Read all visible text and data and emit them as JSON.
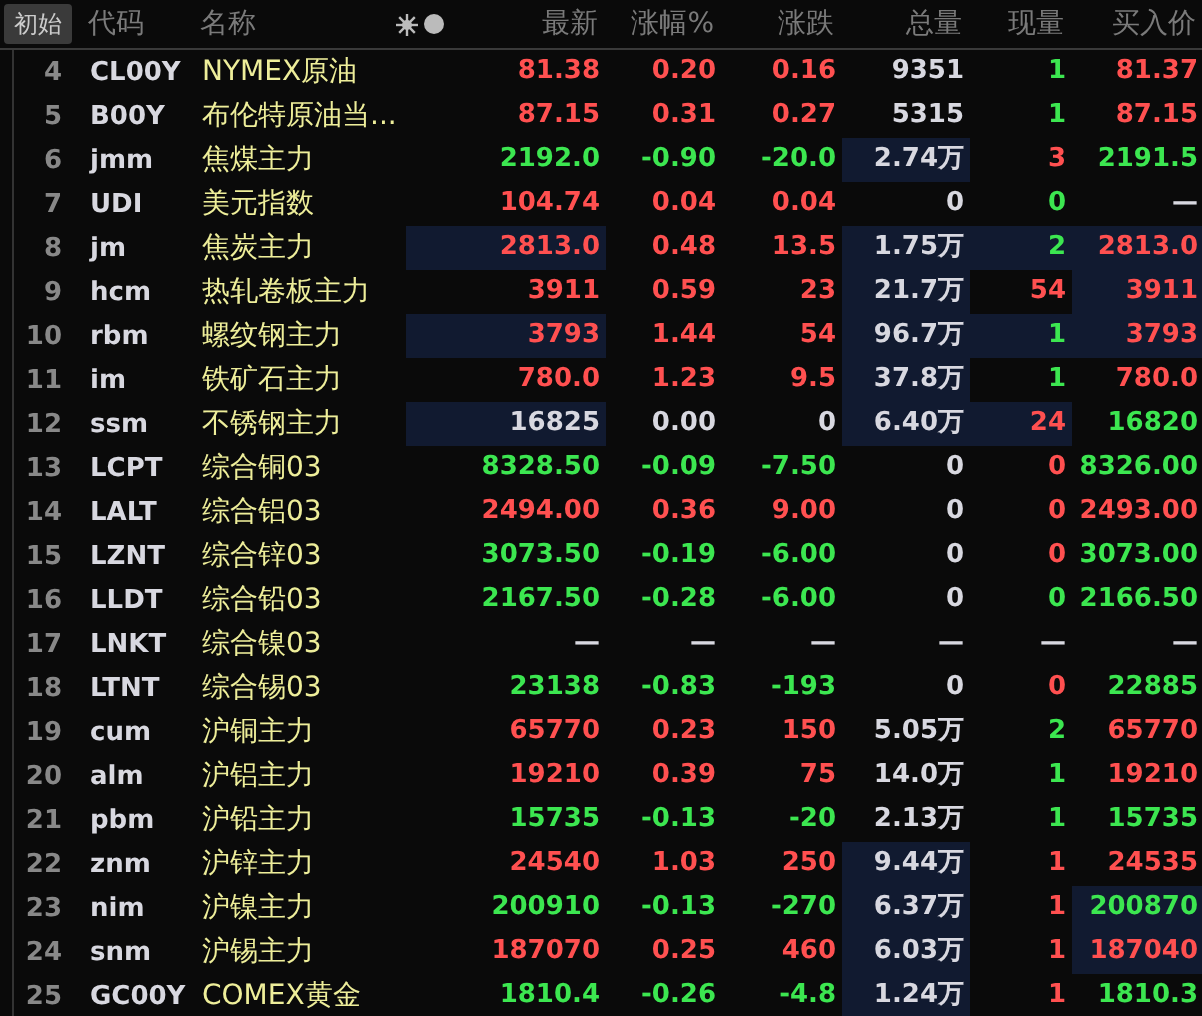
{
  "header": {
    "reset_button": "初始",
    "columns": [
      "代码",
      "名称",
      "最新",
      "涨幅%",
      "涨跌",
      "总量",
      "现量",
      "买入价"
    ]
  },
  "rows": [
    {
      "no": "4",
      "code": "CL00Y",
      "name": "NYMEX原油",
      "cells": [
        {
          "text": "81.38",
          "color": "#ff5050",
          "flash": false
        },
        {
          "text": "0.20",
          "color": "#ff5050",
          "flash": false
        },
        {
          "text": "0.16",
          "color": "#ff5050",
          "flash": false
        },
        {
          "text": "9351",
          "color": "#d8d8e0",
          "flash": false
        },
        {
          "text": "1",
          "color": "#3ce650",
          "flash": false
        },
        {
          "text": "81.37",
          "color": "#ff5050",
          "flash": false
        }
      ]
    },
    {
      "no": "5",
      "code": "B00Y",
      "name": "布伦特原油当...",
      "cells": [
        {
          "text": "87.15",
          "color": "#ff5050",
          "flash": false
        },
        {
          "text": "0.31",
          "color": "#ff5050",
          "flash": false
        },
        {
          "text": "0.27",
          "color": "#ff5050",
          "flash": false
        },
        {
          "text": "5315",
          "color": "#d8d8e0",
          "flash": false
        },
        {
          "text": "1",
          "color": "#3ce650",
          "flash": false
        },
        {
          "text": "87.15",
          "color": "#ff5050",
          "flash": false
        }
      ]
    },
    {
      "no": "6",
      "code": "jmm",
      "name": "焦煤主力",
      "cells": [
        {
          "text": "2192.0",
          "color": "#3ce650",
          "flash": false
        },
        {
          "text": "-0.90",
          "color": "#3ce650",
          "flash": false
        },
        {
          "text": "-20.0",
          "color": "#3ce650",
          "flash": false
        },
        {
          "text": "2.74万",
          "color": "#d8d8e0",
          "flash": true
        },
        {
          "text": "3",
          "color": "#ff5050",
          "flash": false
        },
        {
          "text": "2191.5",
          "color": "#3ce650",
          "flash": false
        }
      ]
    },
    {
      "no": "7",
      "code": "UDI",
      "name": "美元指数",
      "cells": [
        {
          "text": "104.74",
          "color": "#ff5050",
          "flash": false
        },
        {
          "text": "0.04",
          "color": "#ff5050",
          "flash": false
        },
        {
          "text": "0.04",
          "color": "#ff5050",
          "flash": false
        },
        {
          "text": "0",
          "color": "#d8d8e0",
          "flash": false
        },
        {
          "text": "0",
          "color": "#3ce650",
          "flash": false
        },
        {
          "text": "—",
          "color": "#d8d8e0",
          "flash": false
        }
      ]
    },
    {
      "no": "8",
      "code": "jm",
      "name": "焦炭主力",
      "cells": [
        {
          "text": "2813.0",
          "color": "#ff5050",
          "flash": true
        },
        {
          "text": "0.48",
          "color": "#ff5050",
          "flash": false
        },
        {
          "text": "13.5",
          "color": "#ff5050",
          "flash": false
        },
        {
          "text": "1.75万",
          "color": "#d8d8e0",
          "flash": true
        },
        {
          "text": "2",
          "color": "#3ce650",
          "flash": true
        },
        {
          "text": "2813.0",
          "color": "#ff5050",
          "flash": true
        }
      ]
    },
    {
      "no": "9",
      "code": "hcm",
      "name": "热轧卷板主力",
      "cells": [
        {
          "text": "3911",
          "color": "#ff5050",
          "flash": false
        },
        {
          "text": "0.59",
          "color": "#ff5050",
          "flash": false
        },
        {
          "text": "23",
          "color": "#ff5050",
          "flash": false
        },
        {
          "text": "21.7万",
          "color": "#d8d8e0",
          "flash": true
        },
        {
          "text": "54",
          "color": "#ff5050",
          "flash": false
        },
        {
          "text": "3911",
          "color": "#ff5050",
          "flash": true
        }
      ]
    },
    {
      "no": "10",
      "code": "rbm",
      "name": "螺纹钢主力",
      "cells": [
        {
          "text": "3793",
          "color": "#ff5050",
          "flash": true
        },
        {
          "text": "1.44",
          "color": "#ff5050",
          "flash": false
        },
        {
          "text": "54",
          "color": "#ff5050",
          "flash": false
        },
        {
          "text": "96.7万",
          "color": "#d8d8e0",
          "flash": true
        },
        {
          "text": "1",
          "color": "#3ce650",
          "flash": true
        },
        {
          "text": "3793",
          "color": "#ff5050",
          "flash": true
        }
      ]
    },
    {
      "no": "11",
      "code": "im",
      "name": "铁矿石主力",
      "cells": [
        {
          "text": "780.0",
          "color": "#ff5050",
          "flash": false
        },
        {
          "text": "1.23",
          "color": "#ff5050",
          "flash": false
        },
        {
          "text": "9.5",
          "color": "#ff5050",
          "flash": false
        },
        {
          "text": "37.8万",
          "color": "#d8d8e0",
          "flash": true
        },
        {
          "text": "1",
          "color": "#3ce650",
          "flash": false
        },
        {
          "text": "780.0",
          "color": "#ff5050",
          "flash": false
        }
      ]
    },
    {
      "no": "12",
      "code": "ssm",
      "name": "不锈钢主力",
      "cells": [
        {
          "text": "16825",
          "color": "#d8d8e0",
          "flash": true
        },
        {
          "text": "0.00",
          "color": "#d8d8e0",
          "flash": false
        },
        {
          "text": "0",
          "color": "#d8d8e0",
          "flash": false
        },
        {
          "text": "6.40万",
          "color": "#d8d8e0",
          "flash": true
        },
        {
          "text": "24",
          "color": "#ff5050",
          "flash": true
        },
        {
          "text": "16820",
          "color": "#3ce650",
          "flash": false
        }
      ]
    },
    {
      "no": "13",
      "code": "LCPT",
      "name": "综合铜03",
      "cells": [
        {
          "text": "8328.50",
          "color": "#3ce650",
          "flash": false
        },
        {
          "text": "-0.09",
          "color": "#3ce650",
          "flash": false
        },
        {
          "text": "-7.50",
          "color": "#3ce650",
          "flash": false
        },
        {
          "text": "0",
          "color": "#d8d8e0",
          "flash": false
        },
        {
          "text": "0",
          "color": "#ff5050",
          "flash": false
        },
        {
          "text": "8326.00",
          "color": "#3ce650",
          "flash": false
        }
      ]
    },
    {
      "no": "14",
      "code": "LALT",
      "name": "综合铝03",
      "cells": [
        {
          "text": "2494.00",
          "color": "#ff5050",
          "flash": false
        },
        {
          "text": "0.36",
          "color": "#ff5050",
          "flash": false
        },
        {
          "text": "9.00",
          "color": "#ff5050",
          "flash": false
        },
        {
          "text": "0",
          "color": "#d8d8e0",
          "flash": false
        },
        {
          "text": "0",
          "color": "#ff5050",
          "flash": false
        },
        {
          "text": "2493.00",
          "color": "#ff5050",
          "flash": false
        }
      ]
    },
    {
      "no": "15",
      "code": "LZNT",
      "name": "综合锌03",
      "cells": [
        {
          "text": "3073.50",
          "color": "#3ce650",
          "flash": false
        },
        {
          "text": "-0.19",
          "color": "#3ce650",
          "flash": false
        },
        {
          "text": "-6.00",
          "color": "#3ce650",
          "flash": false
        },
        {
          "text": "0",
          "color": "#d8d8e0",
          "flash": false
        },
        {
          "text": "0",
          "color": "#ff5050",
          "flash": false
        },
        {
          "text": "3073.00",
          "color": "#3ce650",
          "flash": false
        }
      ]
    },
    {
      "no": "16",
      "code": "LLDT",
      "name": "综合铅03",
      "cells": [
        {
          "text": "2167.50",
          "color": "#3ce650",
          "flash": false
        },
        {
          "text": "-0.28",
          "color": "#3ce650",
          "flash": false
        },
        {
          "text": "-6.00",
          "color": "#3ce650",
          "flash": false
        },
        {
          "text": "0",
          "color": "#d8d8e0",
          "flash": false
        },
        {
          "text": "0",
          "color": "#3ce650",
          "flash": false
        },
        {
          "text": "2166.50",
          "color": "#3ce650",
          "flash": false
        }
      ]
    },
    {
      "no": "17",
      "code": "LNKT",
      "name": "综合镍03",
      "cells": [
        {
          "text": "—",
          "color": "#d8d8e0",
          "flash": false
        },
        {
          "text": "—",
          "color": "#d8d8e0",
          "flash": false
        },
        {
          "text": "—",
          "color": "#d8d8e0",
          "flash": false
        },
        {
          "text": "—",
          "color": "#d8d8e0",
          "flash": false
        },
        {
          "text": "—",
          "color": "#d8d8e0",
          "flash": false
        },
        {
          "text": "—",
          "color": "#d8d8e0",
          "flash": false
        }
      ]
    },
    {
      "no": "18",
      "code": "LTNT",
      "name": "综合锡03",
      "cells": [
        {
          "text": "23138",
          "color": "#3ce650",
          "flash": false
        },
        {
          "text": "-0.83",
          "color": "#3ce650",
          "flash": false
        },
        {
          "text": "-193",
          "color": "#3ce650",
          "flash": false
        },
        {
          "text": "0",
          "color": "#d8d8e0",
          "flash": false
        },
        {
          "text": "0",
          "color": "#ff5050",
          "flash": false
        },
        {
          "text": "22885",
          "color": "#3ce650",
          "flash": false
        }
      ]
    },
    {
      "no": "19",
      "code": "cum",
      "name": "沪铜主力",
      "cells": [
        {
          "text": "65770",
          "color": "#ff5050",
          "flash": false
        },
        {
          "text": "0.23",
          "color": "#ff5050",
          "flash": false
        },
        {
          "text": "150",
          "color": "#ff5050",
          "flash": false
        },
        {
          "text": "5.05万",
          "color": "#d8d8e0",
          "flash": false
        },
        {
          "text": "2",
          "color": "#3ce650",
          "flash": false
        },
        {
          "text": "65770",
          "color": "#ff5050",
          "flash": false
        }
      ]
    },
    {
      "no": "20",
      "code": "alm",
      "name": "沪铝主力",
      "cells": [
        {
          "text": "19210",
          "color": "#ff5050",
          "flash": false
        },
        {
          "text": "0.39",
          "color": "#ff5050",
          "flash": false
        },
        {
          "text": "75",
          "color": "#ff5050",
          "flash": false
        },
        {
          "text": "14.0万",
          "color": "#d8d8e0",
          "flash": false
        },
        {
          "text": "1",
          "color": "#3ce650",
          "flash": false
        },
        {
          "text": "19210",
          "color": "#ff5050",
          "flash": false
        }
      ]
    },
    {
      "no": "21",
      "code": "pbm",
      "name": "沪铅主力",
      "cells": [
        {
          "text": "15735",
          "color": "#3ce650",
          "flash": false
        },
        {
          "text": "-0.13",
          "color": "#3ce650",
          "flash": false
        },
        {
          "text": "-20",
          "color": "#3ce650",
          "flash": false
        },
        {
          "text": "2.13万",
          "color": "#d8d8e0",
          "flash": false
        },
        {
          "text": "1",
          "color": "#3ce650",
          "flash": false
        },
        {
          "text": "15735",
          "color": "#3ce650",
          "flash": false
        }
      ]
    },
    {
      "no": "22",
      "code": "znm",
      "name": "沪锌主力",
      "cells": [
        {
          "text": "24540",
          "color": "#ff5050",
          "flash": false
        },
        {
          "text": "1.03",
          "color": "#ff5050",
          "flash": false
        },
        {
          "text": "250",
          "color": "#ff5050",
          "flash": false
        },
        {
          "text": "9.44万",
          "color": "#d8d8e0",
          "flash": true
        },
        {
          "text": "1",
          "color": "#ff5050",
          "flash": false
        },
        {
          "text": "24535",
          "color": "#ff5050",
          "flash": false
        }
      ]
    },
    {
      "no": "23",
      "code": "nim",
      "name": "沪镍主力",
      "cells": [
        {
          "text": "200910",
          "color": "#3ce650",
          "flash": false
        },
        {
          "text": "-0.13",
          "color": "#3ce650",
          "flash": false
        },
        {
          "text": "-270",
          "color": "#3ce650",
          "flash": false
        },
        {
          "text": "6.37万",
          "color": "#d8d8e0",
          "flash": true
        },
        {
          "text": "1",
          "color": "#ff5050",
          "flash": false
        },
        {
          "text": "200870",
          "color": "#3ce650",
          "flash": true
        }
      ]
    },
    {
      "no": "24",
      "code": "snm",
      "name": "沪锡主力",
      "cells": [
        {
          "text": "187070",
          "color": "#ff5050",
          "flash": false
        },
        {
          "text": "0.25",
          "color": "#ff5050",
          "flash": false
        },
        {
          "text": "460",
          "color": "#ff5050",
          "flash": false
        },
        {
          "text": "6.03万",
          "color": "#d8d8e0",
          "flash": true
        },
        {
          "text": "1",
          "color": "#ff5050",
          "flash": false
        },
        {
          "text": "187040",
          "color": "#ff5050",
          "flash": true
        }
      ]
    },
    {
      "no": "25",
      "code": "GC00Y",
      "name": "COMEX黄金",
      "cells": [
        {
          "text": "1810.4",
          "color": "#3ce650",
          "flash": false
        },
        {
          "text": "-0.26",
          "color": "#3ce650",
          "flash": false
        },
        {
          "text": "-4.8",
          "color": "#3ce650",
          "flash": false
        },
        {
          "text": "1.24万",
          "color": "#d8d8e0",
          "flash": true
        },
        {
          "text": "1",
          "color": "#ff5050",
          "flash": false
        },
        {
          "text": "1810.3",
          "color": "#3ce650",
          "flash": false
        }
      ]
    }
  ]
}
